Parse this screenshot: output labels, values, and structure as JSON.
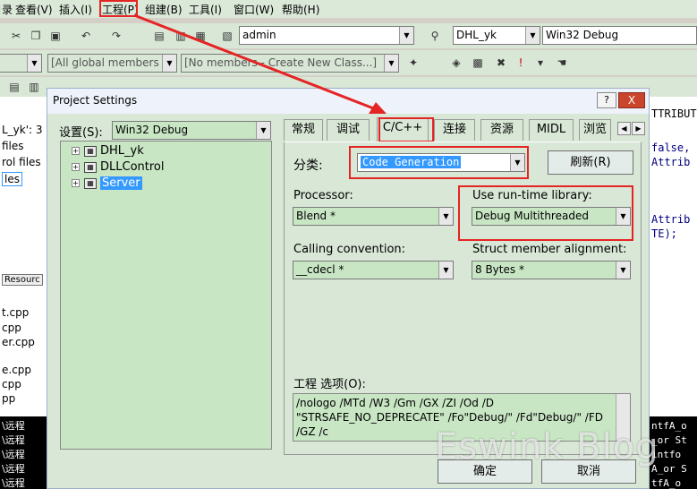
{
  "menubar": {
    "items": [
      "查看(V)",
      "插入(I)",
      "工程(P)",
      "组建(B)",
      "工具(I)",
      "窗口(W)",
      "帮助(H)"
    ],
    "leading": "目录"
  },
  "toolbar": {
    "admin_combo": "admin",
    "project_combo": "DHL_yk",
    "config_combo": "Win32 Debug",
    "members_combo": "[All global members",
    "no_members_combo": "[No members - Create New Class...]"
  },
  "left_pane": {
    "lines": [
      "L_yk': 3",
      "files",
      "rol files",
      "les"
    ],
    "resource_tab": "Resourc",
    "files": [
      "t.cpp",
      "cpp",
      "er.cpp",
      "e.cpp",
      "cpp",
      "pp"
    ],
    "console": [
      "\\远程",
      "\\远程",
      "\\远程",
      "\\远程",
      "\\远程"
    ]
  },
  "right_pane": {
    "lines": [
      "TTRIBUTE",
      "false,",
      "Attrib",
      "Attrib",
      "TE);"
    ],
    "console": [
      "ntfA_o",
      "_or St",
      "intfo",
      "A_or S",
      "tfA_o"
    ]
  },
  "dialog": {
    "title": "Project Settings",
    "help": "?",
    "close": "X",
    "settings_label": "设置(S):",
    "settings_combo": "Win32 Debug",
    "tree": {
      "nodes": [
        "DHL_yk",
        "DLLControl",
        "Server"
      ]
    },
    "tabs": [
      "常规",
      "调试",
      "C/C++",
      "连接",
      "资源",
      "MIDL",
      "浏览"
    ],
    "category_label": "分类:",
    "category_value": "Code Generation",
    "reset_button": "刷新(R)",
    "processor_label": "Processor:",
    "processor_value": "Blend *",
    "runtime_label": "Use run-time library:",
    "runtime_value": "Debug Multithreaded",
    "calling_label": "Calling convention:",
    "calling_value": "__cdecl *",
    "struct_label": "Struct member alignment:",
    "struct_value": "8 Bytes *",
    "options_label": "工程 选项(O):",
    "options_text": "/nologo /MTd /W3 /Gm /GX /ZI /Od /D \"STRSAFE_NO_DEPRECATE\" /Fo\"Debug/\" /Fd\"Debug/\" /FD /GZ /c",
    "ok_button": "确定",
    "cancel_button": "取消"
  },
  "watermark": "Eswink Blog",
  "colors": {
    "highlight": "#e52424",
    "dialog_bg": "#d8e7d6",
    "selection": "#3399ff"
  }
}
